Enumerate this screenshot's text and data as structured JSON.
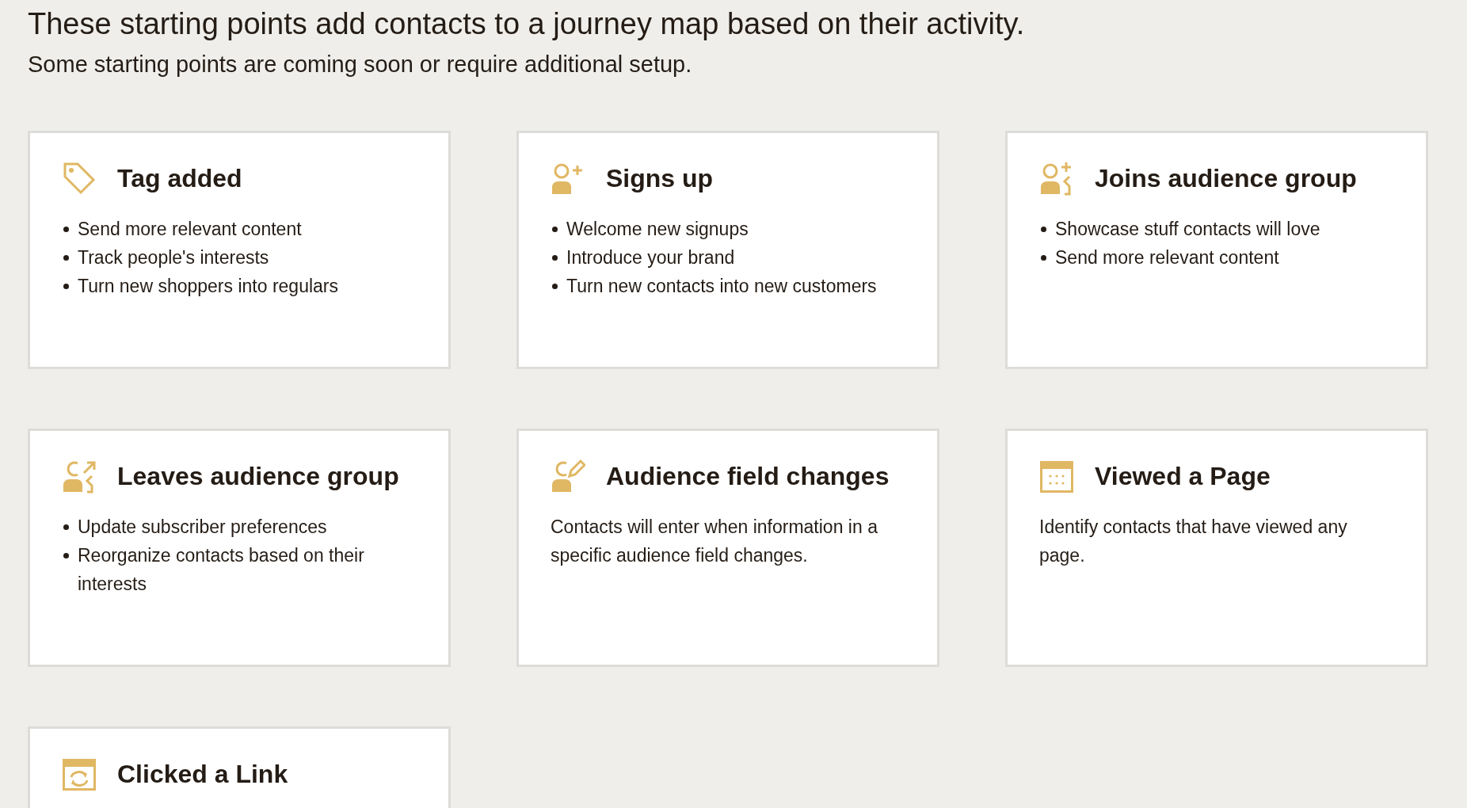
{
  "heading": "These starting points add contacts to a journey map based on their activity.",
  "subheading": "Some starting points are coming soon or require additional setup.",
  "cards": [
    {
      "title": "Tag added",
      "kind": "bullets",
      "items": [
        "Send more relevant content",
        "Track people's interests",
        "Turn new shoppers into regulars"
      ]
    },
    {
      "title": "Signs up",
      "kind": "bullets",
      "items": [
        "Welcome new signups",
        "Introduce your brand",
        "Turn new contacts into new customers"
      ]
    },
    {
      "title": "Joins audience group",
      "kind": "bullets",
      "items": [
        "Showcase stuff contacts will love",
        "Send more relevant content"
      ]
    },
    {
      "title": "Leaves audience group",
      "kind": "bullets",
      "items": [
        "Update subscriber preferences",
        "Reorganize contacts based on their interests"
      ]
    },
    {
      "title": "Audience field changes",
      "kind": "text",
      "text": "Contacts will enter when information in a specific audience field changes."
    },
    {
      "title": "Viewed a Page",
      "kind": "text",
      "text": "Identify contacts that have viewed any page."
    },
    {
      "title": "Clicked a Link",
      "kind": "text"
    }
  ]
}
